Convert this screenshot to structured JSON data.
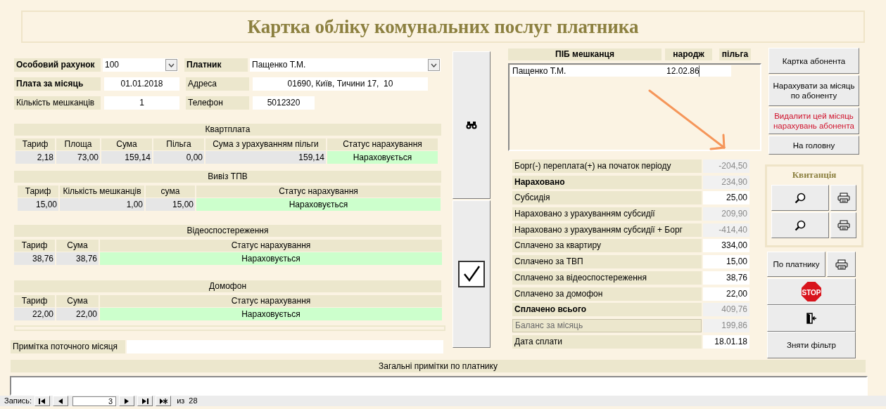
{
  "title": "Картка обліку комунальних послуг платника",
  "fields": [
    {
      "label": "Особовий рахунок",
      "value": "100",
      "kind": "dropdown",
      "bold": true
    },
    {
      "label": "Платник",
      "value": "Пащенко Т.М.",
      "kind": "dropdown",
      "bold": true
    },
    {
      "label": "Плата за місяць",
      "value": "01.01.2018",
      "kind": "text",
      "bold": true
    },
    {
      "label": "Адреса",
      "value": "01690, Київ, Тичини 17,  10",
      "kind": "text",
      "bold": false
    },
    {
      "label": "Кількість мешканців",
      "value": "1",
      "kind": "text",
      "bold": false
    },
    {
      "label": "Телефон",
      "value": "5012320",
      "kind": "text",
      "bold": false
    }
  ],
  "sections": [
    {
      "title": "Квартплата",
      "columns": [
        {
          "label": "Тариф",
          "kind": "number"
        },
        {
          "label": "Площа",
          "kind": "number"
        },
        {
          "label": "Сума",
          "kind": "number"
        },
        {
          "label": "Пільга",
          "kind": "number"
        },
        {
          "label": "Сума з урахуванням пільги",
          "kind": "number"
        },
        {
          "label": "Статус нарахування",
          "kind": "status"
        }
      ],
      "rows": [
        [
          "2,18",
          "73,00",
          "159,14",
          "0,00",
          "159,14",
          "Нараховується"
        ]
      ]
    },
    {
      "title": "Вивіз ТПВ",
      "columns": [
        {
          "label": "Тариф",
          "kind": "number"
        },
        {
          "label": "Кількість мешканців",
          "kind": "number"
        },
        {
          "label": "сума",
          "kind": "number"
        },
        {
          "label": "Статус нарахування",
          "kind": "status"
        }
      ],
      "rows": [
        [
          "15,00",
          "1,00",
          "15,00",
          "Нараховується"
        ]
      ]
    },
    {
      "title": "Відеоспостереження",
      "columns": [
        {
          "label": "Тариф",
          "kind": "number"
        },
        {
          "label": "Сума",
          "kind": "number"
        },
        {
          "label": "Статус нарахування",
          "kind": "status"
        }
      ],
      "rows": [
        [
          "38,76",
          "38,76",
          "Нараховується"
        ]
      ]
    },
    {
      "title": "Домофон",
      "columns": [
        {
          "label": "Тариф",
          "kind": "number"
        },
        {
          "label": "Сума",
          "kind": "number"
        },
        {
          "label": "Статус нарахування",
          "kind": "status"
        }
      ],
      "rows": [
        [
          "22,00",
          "22,00",
          "Нараховується"
        ]
      ]
    }
  ],
  "note": {
    "label": "Примітка поточного місяця"
  },
  "residents": {
    "columns": [
      "ПІБ мешканця",
      "народж",
      "пільга"
    ],
    "rows": [
      {
        "name": "Пащенко Т.М.",
        "birth": "12.02.86"
      }
    ]
  },
  "summary": [
    {
      "label": "Борг(-) переплата(+) на початок періоду",
      "value": "-204,50",
      "bold": false,
      "editable": false,
      "disabled": false
    },
    {
      "label": "Нараховано",
      "value": "234,90",
      "bold": true,
      "editable": false,
      "disabled": false
    },
    {
      "label": "Субсидія",
      "value": "25,00",
      "bold": false,
      "editable": true,
      "disabled": false
    },
    {
      "label": "Нараховано з урахуванням субсидії",
      "value": "209,90",
      "bold": false,
      "editable": false,
      "disabled": false
    },
    {
      "label": "Нараховано з урахуванням субсидії + Борг",
      "value": "-414,40",
      "bold": false,
      "editable": false,
      "disabled": false
    },
    {
      "label": "Сплачено за квартиру",
      "value": "334,00",
      "bold": false,
      "editable": true,
      "disabled": false
    },
    {
      "label": "Сплачено за ТВП",
      "value": "15,00",
      "bold": false,
      "editable": true,
      "disabled": false
    },
    {
      "label": "Сплачено за відеоспостереження",
      "value": "38,76",
      "bold": false,
      "editable": true,
      "disabled": false
    },
    {
      "label": "Сплачено за домофон",
      "value": "22,00",
      "bold": false,
      "editable": true,
      "disabled": false
    },
    {
      "label": "Сплачено всього",
      "value": "409,76",
      "bold": true,
      "editable": false,
      "disabled": false
    },
    {
      "label": "Баланс за місяць",
      "value": "199,86",
      "bold": false,
      "editable": false,
      "disabled": true
    },
    {
      "label": "Дата сплати",
      "value": "18.01.18",
      "bold": false,
      "editable": true,
      "disabled": false
    }
  ],
  "actions": [
    {
      "label": "Картка абонента",
      "danger": false
    },
    {
      "label": "Нарахувати за місяць по абоненту",
      "danger": false
    },
    {
      "label": "Видалити цей місяць нарахувань абонента",
      "danger": true
    },
    {
      "label": "На головну",
      "danger": false
    }
  ],
  "receipt": {
    "title": "Квитанція"
  },
  "payer_button": {
    "label": "По платнику"
  },
  "stop_sign": "STOP",
  "filter_button": {
    "label": "Зняти фільтр"
  },
  "general_notes": {
    "label": "Загальні примітки по платнику"
  },
  "navigator": {
    "label": "Запись:",
    "current": "3",
    "of": "из",
    "total": "28"
  }
}
